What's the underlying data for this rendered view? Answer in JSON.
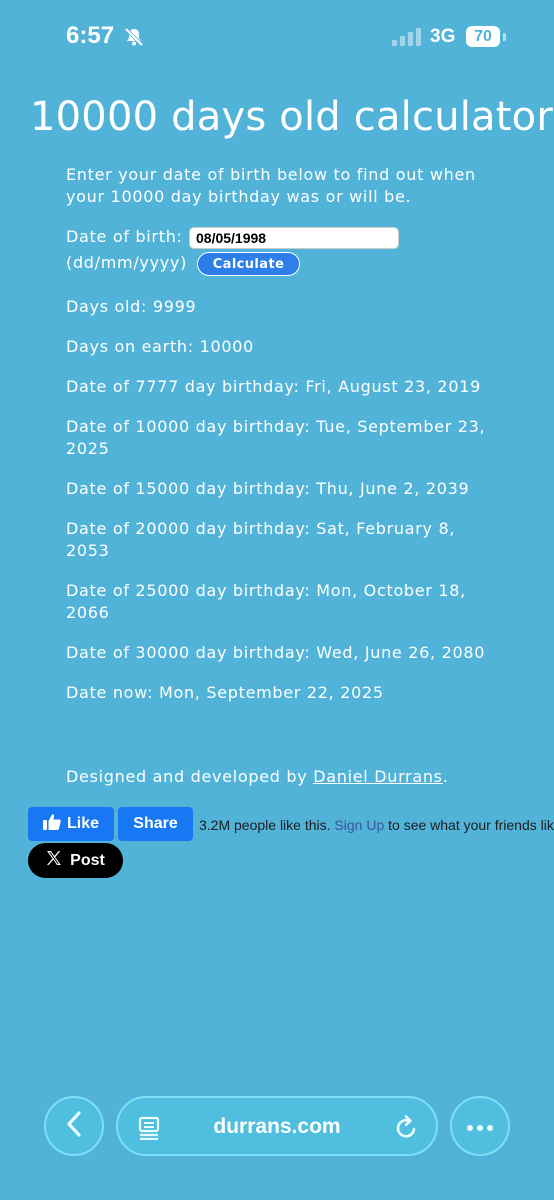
{
  "status_bar": {
    "time": "6:57",
    "network": "3G",
    "battery": "70"
  },
  "page": {
    "title": "10000 days old calculator",
    "intro": "Enter your date of birth below to find out when your 10000 day birthday was or will be.",
    "dob_label": "Date of birth:",
    "dob_value": "08/05/1998",
    "dob_format": "(dd/mm/yyyy)",
    "calculate_label": "Calculate",
    "results": [
      "Days old: 9999",
      "Days on earth: 10000",
      "Date of 7777 day birthday: Fri, August 23, 2019",
      "Date of 10000 day birthday: Tue, September 23, 2025",
      "Date of 15000 day birthday: Thu, June 2, 2039",
      "Date of 20000 day birthday: Sat, February 8, 2053",
      "Date of 25000 day birthday: Mon, October 18, 2066",
      "Date of 30000 day birthday: Wed, June 26, 2080",
      "Date now: Mon, September 22, 2025"
    ],
    "credit_prefix": "Designed and developed by ",
    "credit_link": "Daniel Durrans",
    "credit_suffix": "."
  },
  "social": {
    "like_label": "Like",
    "share_label": "Share",
    "like_count_text": "3.2M people like this.",
    "signup_link": "Sign Up",
    "signup_suffix": "to see what your friends like.",
    "post_label": "Post"
  },
  "browser": {
    "url": "durrans.com"
  },
  "colors": {
    "background": "#52b3d9",
    "button": "#2d7ee8",
    "facebook": "#1877f2"
  }
}
